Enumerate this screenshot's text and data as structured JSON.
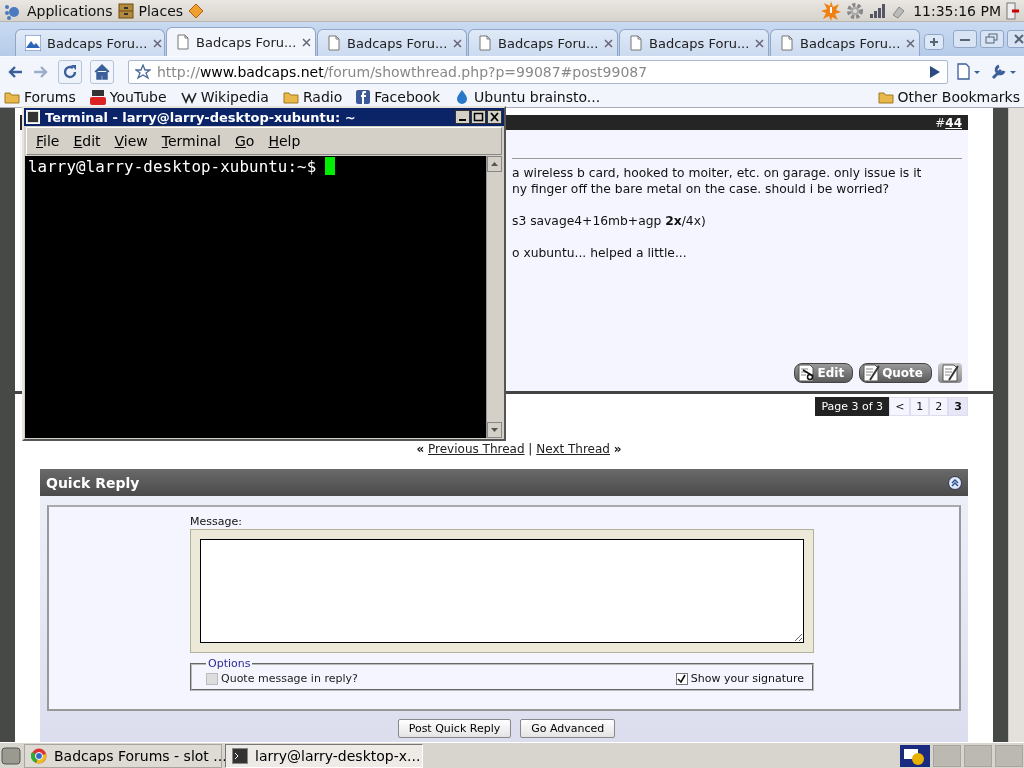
{
  "top_panel": {
    "menus": [
      "Applications",
      "Places"
    ],
    "clock": "11:35:16 PM"
  },
  "browser": {
    "tabs": [
      {
        "title": "Badcaps Foru...",
        "selected": false,
        "kind": "site"
      },
      {
        "title": "Badcaps Foru...",
        "selected": true,
        "kind": "page"
      },
      {
        "title": "Badcaps Foru...",
        "selected": false,
        "kind": "page"
      },
      {
        "title": "Badcaps Foru...",
        "selected": false,
        "kind": "page"
      },
      {
        "title": "Badcaps Foru...",
        "selected": false,
        "kind": "page"
      },
      {
        "title": "Badcaps Foru...",
        "selected": false,
        "kind": "page"
      }
    ],
    "url": {
      "scheme": "http://",
      "host": "www.badcaps.net",
      "path": "/forum/showthread.php?p=99087#post99087"
    },
    "bookmarks": [
      {
        "label": "Forums",
        "kind": "folder"
      },
      {
        "label": "YouTube",
        "kind": "youtube"
      },
      {
        "label": "Wikipedia",
        "kind": "wiki"
      },
      {
        "label": "Radio",
        "kind": "folder"
      },
      {
        "label": "Facebook",
        "kind": "facebook"
      },
      {
        "label": "Ubuntu brainsto...",
        "kind": "ubuntu"
      }
    ],
    "other_bookmarks": "Other Bookmarks"
  },
  "post": {
    "number_prefix": "#",
    "number": "44",
    "paragraphs": [
      [
        "a wireless b card, hooked to moiter, etc. on garage. only issue is it",
        "ny finger off the bare metal on the case. should i be worried?"
      ],
      [
        "s3 savage4+16mb+agp **2x**/4x)"
      ],
      [
        "o xubuntu... helped a little..."
      ]
    ],
    "buttons": [
      "Edit",
      "Quote"
    ]
  },
  "pagination": {
    "label": "Page 3 of 3",
    "previous": "<",
    "pages": [
      {
        "label": "1",
        "selected": false
      },
      {
        "label": "2",
        "selected": false
      },
      {
        "label": "3",
        "selected": true
      }
    ]
  },
  "thread_nav": {
    "previous_mark": "«",
    "previous": "Previous Thread",
    "separator": "|",
    "next": "Next Thread",
    "next_mark": "»"
  },
  "quick_reply": {
    "title": "Quick Reply",
    "message_label": "Message:",
    "options_legend": "Options",
    "options": [
      {
        "label": "Quote message in reply?",
        "checked": false,
        "disabled": true
      },
      {
        "label": "Show your signature",
        "checked": true,
        "disabled": false
      }
    ],
    "buttons": [
      "Post Quick Reply",
      "Go Advanced"
    ]
  },
  "terminal": {
    "title": "Terminal - larry@larry-desktop-xubuntu: ~",
    "menus": [
      "File",
      "Edit",
      "View",
      "Terminal",
      "Go",
      "Help"
    ],
    "prompt": "larry@larry-desktop-xubuntu:~$"
  },
  "taskbar": {
    "tasks": [
      {
        "label": "Badcaps Forums - slot ...",
        "selected": false,
        "kind": "browser"
      },
      {
        "label": "larry@larry-desktop-x...",
        "selected": true,
        "kind": "terminal"
      }
    ]
  }
}
